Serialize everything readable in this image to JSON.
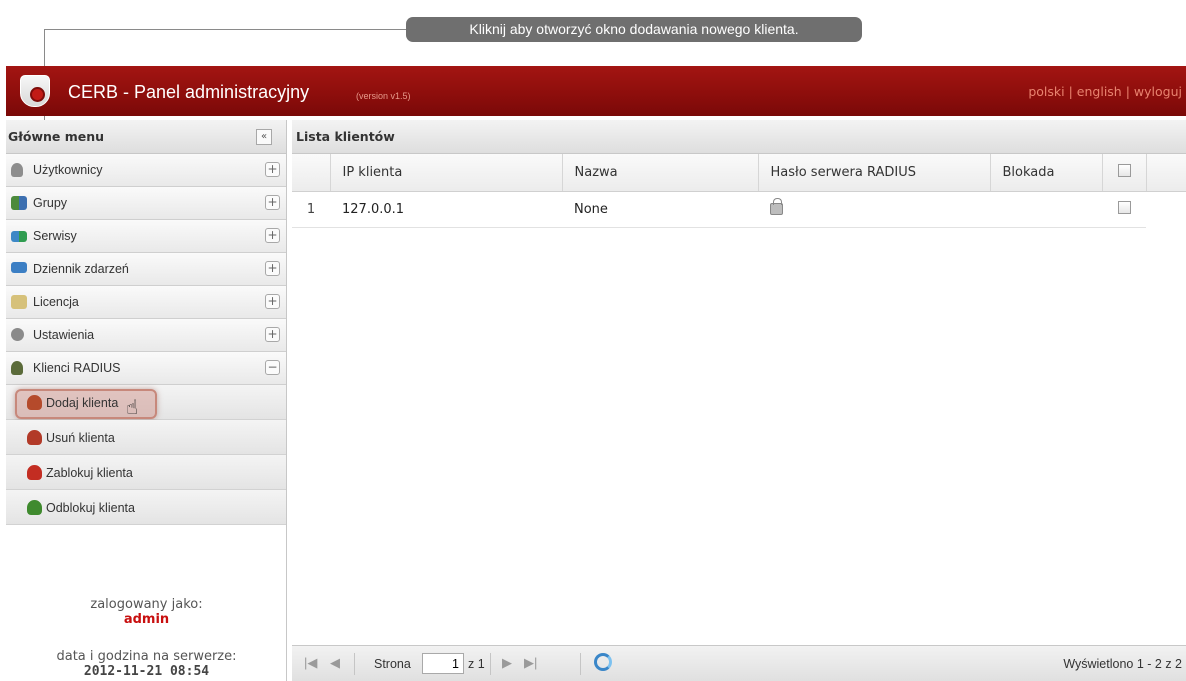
{
  "tooltip": "Kliknij aby otworzyć okno dodawania nowego klienta.",
  "header": {
    "title": "CERB - Panel administracyjny",
    "version": "(version v1.5)",
    "lang_polish": "polski",
    "lang_english": "english",
    "logout": "wyloguj",
    "separator": "|"
  },
  "sidebar": {
    "title": "Główne menu",
    "collapse_icon": "«",
    "items": [
      {
        "label": "Użytkownicy",
        "icon": "user-icon",
        "toggle": "+"
      },
      {
        "label": "Grupy",
        "icon": "group-icon",
        "toggle": "+"
      },
      {
        "label": "Serwisy",
        "icon": "services-icon",
        "toggle": "+"
      },
      {
        "label": "Dziennik zdarzeń",
        "icon": "monitor-icon",
        "toggle": "+"
      },
      {
        "label": "Licencja",
        "icon": "license-icon",
        "toggle": "+"
      },
      {
        "label": "Ustawienia",
        "icon": "settings-icon",
        "toggle": "+"
      },
      {
        "label": "Klienci RADIUS",
        "icon": "traffic-light-icon",
        "toggle": "−"
      }
    ],
    "sub_items": [
      {
        "label": "Dodaj klienta",
        "icon": "add-client-icon"
      },
      {
        "label": "Usuń klienta",
        "icon": "remove-client-icon"
      },
      {
        "label": "Zablokuj klienta",
        "icon": "block-client-icon"
      },
      {
        "label": "Odblokuj klienta",
        "icon": "unblock-client-icon"
      }
    ],
    "logged_as_label": "zalogowany jako:",
    "username": "admin",
    "server_time_label": "data i godzina na serwerze:",
    "server_time": "2012-11-21 08:54"
  },
  "main": {
    "title": "Lista klientów",
    "columns": [
      "IP klienta",
      "Nazwa",
      "Hasło serwera RADIUS",
      "Blokada"
    ],
    "rows": [
      {
        "num": "1",
        "ip": "127.0.0.1",
        "name": "None",
        "password_icon": "lock-icon",
        "blocked": ""
      }
    ],
    "pager": {
      "page_label": "Strona",
      "page_value": "1",
      "of_label": "z 1",
      "display_info": "Wyświetlono 1 - 2 z 2"
    }
  },
  "colors": {
    "header_red": "#8e0e0c",
    "username_red": "#c80f0f",
    "tooltip_gray": "#6f6f6f"
  }
}
